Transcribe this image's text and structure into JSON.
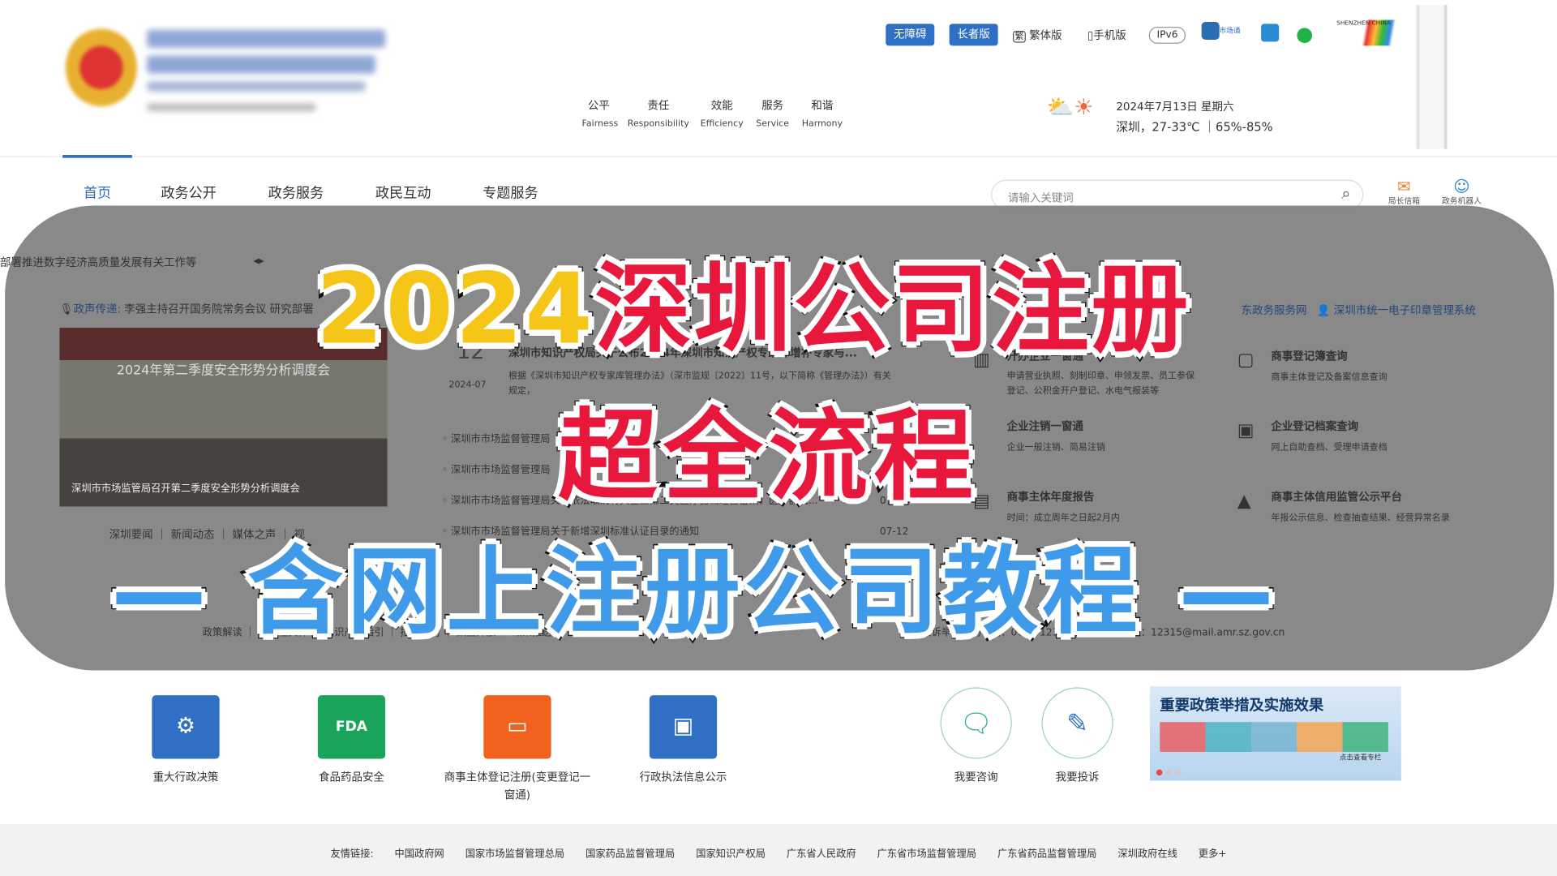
{
  "header": {
    "top_buttons": [
      "无障碍",
      "长者版"
    ],
    "traditional": "繁体版",
    "traditional_icon": "繁",
    "mobile": "手机版",
    "ipv6": "IPv6",
    "shichang": "市场通",
    "motto": [
      {
        "zh": "公平",
        "en": "Fairness"
      },
      {
        "zh": "责任",
        "en": "Responsibility"
      },
      {
        "zh": "效能",
        "en": "Efficiency"
      },
      {
        "zh": "服务",
        "en": "Service"
      },
      {
        "zh": "和谐",
        "en": "Harmony"
      }
    ],
    "weather": {
      "date": "2024年7月13日 星期六",
      "info": "深圳，27-33℃ ｜65%-85%"
    },
    "shenzhen_logo": "SHENZHEN CHINA"
  },
  "nav": {
    "items": [
      "首页",
      "政务公开",
      "政务服务",
      "政民互动",
      "专题服务"
    ],
    "active": 0,
    "search_placeholder": "请输入关键词",
    "mailbox": "局长信箱",
    "robot": "政务机器人"
  },
  "under": {
    "ticker": "部署推进数字经济高质量发展有关工作等",
    "voice_label": "政声传递:",
    "voice_text": "李强主持召开国务院常务会议 研究部署",
    "photo_caption": "深圳市市场监管局召开第二季度安全形势分析调度会",
    "photo_banner": "2024年第二季度安全形势分析调度会",
    "news_day": "12",
    "news_month": "2024-07",
    "news_title": "深圳市知识产权局关于公布2024年深圳市知识产权专家库增补专家与...",
    "news_summary": "根据《深圳市知识产权专家库管理办法》（深市监规〔2022〕11号，以下简称《管理办法》）有关规定，",
    "news_items": [
      {
        "t": "深圳市市场监督管理局",
        "d": ""
      },
      {
        "t": "深圳市市场监督管理局",
        "d": ""
      },
      {
        "t": "深圳市市场监督管理局关于依法取消有关企业第二类医疗器械经营备案、医疗器械...",
        "d": "07-12"
      },
      {
        "t": "深圳市市场监督管理局关于新增深圳标准认证目录的通知",
        "d": "07-12"
      }
    ],
    "tabs": "深圳要闻 ｜ 新闻动态 ｜ 媒体之声 ｜ 视",
    "links_left": "政策解读 ｜ 规范性文件 ｜ 知识产权指引 ｜ 招标采购 ｜ 数据开放 ｜ 政策推送 ｜ 网上投票",
    "links_right": "投诉举报咨询电话：0755-12315　投诉举报邮箱：12315@mail.amr.sz.gov.cn",
    "top_links": [
      "东政务服务网",
      "深圳市统一电子印章管理系统"
    ],
    "services": [
      {
        "title": "开办企业一窗通",
        "desc": "申请营业执照、刻制印章、申领发票、员工参保登记、公积金开户登记、水电气报装等"
      },
      {
        "title": "企业注销一窗通",
        "desc": "企业一般注销、简易注销"
      },
      {
        "title": "商事主体年度报告",
        "desc": "时间：成立周年之日起2月内"
      },
      {
        "title": "商事登记簿查询",
        "desc": "商事主体登记及备案信息查询"
      },
      {
        "title": "企业登记档案查询",
        "desc": "网上自助查档、受理申请查档"
      },
      {
        "title": "商事主体信用监管公示平台",
        "desc": "年报公示信息、检查抽查结果、经营异常名录"
      }
    ]
  },
  "overlay": {
    "line1_year": "2024",
    "line1_rest": "深圳公司注册",
    "line2": "超全流程",
    "line3": "— 含网上注册公司教程 —"
  },
  "quick": [
    {
      "label": "重大行政决策",
      "color": "#2f6fc4",
      "icon": "people-icon"
    },
    {
      "label": "食品药品安全",
      "color": "#1aa35a",
      "icon": "fda-icon"
    },
    {
      "label": "商事主体登记注册(变更登记一窗通)",
      "color": "#f0621e",
      "icon": "screen-icon"
    },
    {
      "label": "行政执法信息公示",
      "color": "#2f6fc4",
      "icon": "id-card-icon"
    }
  ],
  "consult": "我要咨询",
  "complain": "我要投诉",
  "banner": {
    "title": "重要政策举措及实施效果",
    "sub": "点击查看专栏"
  },
  "footer": {
    "label": "友情链接:",
    "links": [
      "中国政府网",
      "国家市场监督管理总局",
      "国家药品监督管理局",
      "国家知识产权局",
      "广东省人民政府",
      "广东省市场监督管理局",
      "广东省药品监督管理局",
      "深圳政府在线",
      "更多+"
    ]
  }
}
